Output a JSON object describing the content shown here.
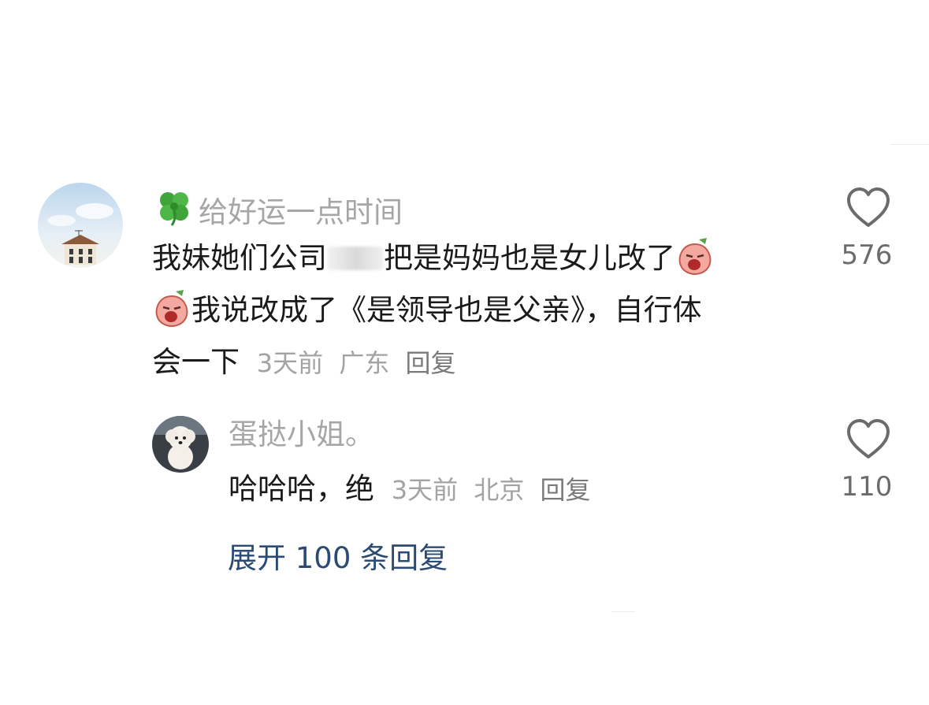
{
  "comment": {
    "username": "给好运一点时间",
    "username_icon": "four-leaf-clover-icon",
    "text_part1": "我妹她们公司",
    "text_part2": "把是妈妈也是女儿改了",
    "text_line2": "我说改成了《是领导也是父亲》，自行体",
    "text_line3": "会一下",
    "time": "3天前",
    "location": "广东",
    "reply_label": "回复",
    "like_count": "576",
    "emoji": "crying-peach-emoji"
  },
  "reply": {
    "username": "蛋挞小姐。",
    "text": "哈哈哈，绝",
    "time": "3天前",
    "location": "北京",
    "reply_label": "回复",
    "like_count": "110"
  },
  "expand_label": "展开 100 条回复",
  "colors": {
    "username": "#a6a6a6",
    "text": "#1a1a1a",
    "meta": "#a3a3a3",
    "expand_link": "#2b4b74",
    "like_icon": "#6b6b6b"
  }
}
